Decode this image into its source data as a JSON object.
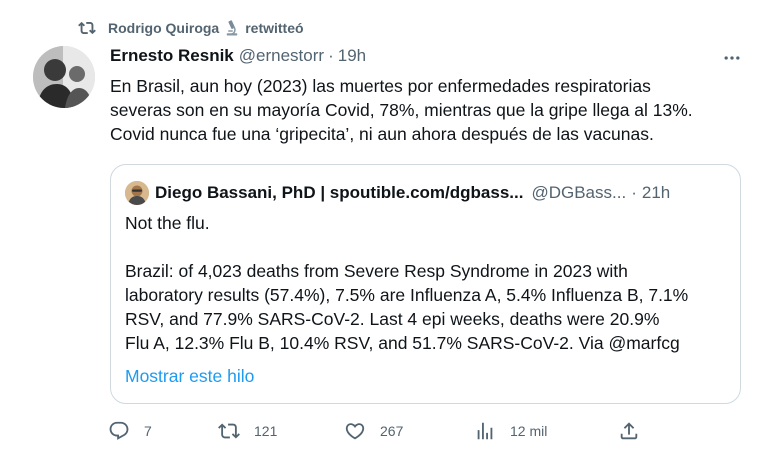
{
  "retweet": {
    "user": "Rodrigo Quiroga",
    "emoji_icon": "microscope-icon",
    "action": "retwitteó"
  },
  "tweet": {
    "author_name": "Ernesto Resnik",
    "author_handle": "@ernestorr",
    "separator": "·",
    "time": "19h",
    "text_lines": [
      "En Brasil, aun hoy (2023) las muertes por enfermedades respiratorias",
      "severas son en su mayoría Covid, 78%, mientras que la gripe llega al 13%.",
      "Covid nunca fue una ‘gripecita’, ni aun ahora después de las vacunas."
    ]
  },
  "quote": {
    "author_name": "Diego Bassani, PhD | spoutible.com/dgbass...",
    "author_handle": "@DGBass...",
    "separator": "·",
    "time": "21h",
    "text_lines": [
      "Not the flu.",
      "",
      "Brazil: of 4,023 deaths from Severe Resp Syndrome in 2023 with",
      "laboratory results (57.4%), 7.5% are Influenza A, 5.4% Influenza B, 7.1%",
      "RSV, and 77.9% SARS-CoV-2. Last 4 epi weeks, deaths were 20.9%",
      "Flu A, 12.3% Flu B, 10.4% RSV, and 51.7% SARS-CoV-2. Via @marfcg"
    ],
    "show_thread": "Mostrar este hilo"
  },
  "actions": {
    "replies": "7",
    "retweets": "121",
    "likes": "267",
    "views": "12 mil"
  },
  "colors": {
    "text": "#0f1419",
    "secondary": "#536471",
    "link": "#1d9bf0",
    "border": "#cfd9de"
  }
}
